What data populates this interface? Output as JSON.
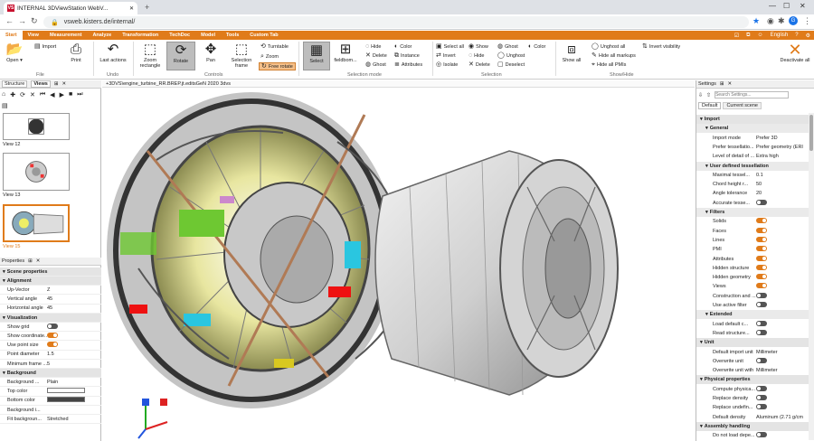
{
  "browser": {
    "tab_title": "INTERNAL 3DViewStation WebV...",
    "favicon_text": "VS",
    "new_tab": "+",
    "url": "vsweb.kisters.de/internal/",
    "profile_initial": "G"
  },
  "menu": {
    "items": [
      "Start",
      "View",
      "Measurement",
      "Analyze",
      "Transformation",
      "TechDoc",
      "Model",
      "Tools",
      "Custom Tab"
    ],
    "active": "Start",
    "language": "English"
  },
  "ribbon": {
    "open": "Open",
    "import": "Import",
    "print": "Print",
    "last_actions": "Last actions",
    "zoom_rectangle": "Zoom rectangle",
    "rotate": "Rotate",
    "pan": "Pan",
    "selection_frame": "Selection frame",
    "turntable": "Turntable",
    "zoom": "Zoom",
    "free_rotate": "Free rotate",
    "select": "Select",
    "fieldbom": "fieldbom...",
    "hide": "Hide",
    "delete": "Delete",
    "ghost": "Ghost",
    "color": "Color",
    "instance": "Instance",
    "attributes": "Attributes",
    "select_all": "Select all",
    "invert": "Invert",
    "isolate": "Isolate",
    "show": "Show",
    "hide2": "Hide",
    "delete2": "Delete",
    "ghost2": "Ghost",
    "unghost": "Unghost",
    "deselect": "Deselect",
    "color2": "Color",
    "show_all": "Show all",
    "unghost_all": "Unghost all",
    "hide_all_markups": "Hide all markups",
    "hide_all_pmis": "Hide all PMIs",
    "invert_visibility": "Invert visibility",
    "deactivate_all": "Deactivate all",
    "groups": {
      "file": "File",
      "undo": "Undo",
      "controls": "Controls",
      "selection_mode": "Selection mode",
      "selection": "Selection",
      "show_hide": "Show/Hide"
    }
  },
  "left": {
    "tabs": [
      "Structure",
      "Views"
    ],
    "views": [
      {
        "label": "View 12"
      },
      {
        "label": "View 13"
      },
      {
        "label": "View 15"
      }
    ],
    "properties_title": "Properties",
    "properties": [
      {
        "type": "section",
        "label": "Scene properties"
      },
      {
        "type": "section",
        "label": "Alignment"
      },
      {
        "type": "row",
        "k": "Up-Vector",
        "v": "Z"
      },
      {
        "type": "row",
        "k": "Vertical angle",
        "v": "45"
      },
      {
        "type": "row",
        "k": "Horizontal angle",
        "v": "45"
      },
      {
        "type": "section",
        "label": "Visualization"
      },
      {
        "type": "toggle",
        "k": "Show grid",
        "on": false
      },
      {
        "type": "toggle",
        "k": "Show coordinate...",
        "on": true
      },
      {
        "type": "toggle",
        "k": "Use point size",
        "on": true
      },
      {
        "type": "row",
        "k": "Point diameter",
        "v": "1.5"
      },
      {
        "type": "row",
        "k": "Minimum frame ...",
        "v": "5"
      },
      {
        "type": "section",
        "label": "Background"
      },
      {
        "type": "row",
        "k": "Background ...",
        "v": "Plain"
      },
      {
        "type": "color",
        "k": "Top color",
        "c": "#ffffff"
      },
      {
        "type": "color",
        "k": "Bottom color",
        "c": "#444444"
      },
      {
        "type": "row",
        "k": "Background i...",
        "v": ""
      },
      {
        "type": "row",
        "k": "Fit backgroun...",
        "v": "Stretched"
      }
    ]
  },
  "viewport": {
    "file_path": "+3DVS\\engine_turbine_RR.BREP.jt.editsGeN 2020 3dvs"
  },
  "settings": {
    "title": "Settings",
    "search_placeholder": "Search Settings...",
    "tabs": [
      "Default",
      "Current scene"
    ],
    "rows": [
      {
        "type": "sec",
        "label": "Import"
      },
      {
        "type": "sub",
        "label": "General"
      },
      {
        "type": "row",
        "k": "Import mode",
        "v": "Prefer 3D"
      },
      {
        "type": "row",
        "k": "Prefer tessellatio...",
        "v": "Prefer geometry (ERI"
      },
      {
        "type": "row",
        "k": "Level of detail of ...",
        "v": "Extra high"
      },
      {
        "type": "sub",
        "label": "User defined tessellation"
      },
      {
        "type": "row",
        "k": "Maximal tessel...",
        "v": "0.1"
      },
      {
        "type": "row",
        "k": "Chord height r...",
        "v": "50"
      },
      {
        "type": "row",
        "k": "Angle tolerance",
        "v": "20"
      },
      {
        "type": "toggle",
        "k": "Accurate tesse...",
        "on": false
      },
      {
        "type": "sub",
        "label": "Filters"
      },
      {
        "type": "toggle",
        "k": "Solids",
        "on": true
      },
      {
        "type": "toggle",
        "k": "Faces",
        "on": true
      },
      {
        "type": "toggle",
        "k": "Lines",
        "on": true
      },
      {
        "type": "toggle",
        "k": "PMI",
        "on": true
      },
      {
        "type": "toggle",
        "k": "Attributes",
        "on": true
      },
      {
        "type": "toggle",
        "k": "Hidden structure",
        "on": true
      },
      {
        "type": "toggle",
        "k": "Hidden geometry",
        "on": true
      },
      {
        "type": "toggle",
        "k": "Views",
        "on": true
      },
      {
        "type": "toggle",
        "k": "Construction and ...",
        "on": false
      },
      {
        "type": "toggle",
        "k": "Use active filter",
        "on": false
      },
      {
        "type": "sub",
        "label": "Extended"
      },
      {
        "type": "toggle",
        "k": "Load default c...",
        "on": false
      },
      {
        "type": "toggle",
        "k": "Read structure...",
        "on": false
      },
      {
        "type": "sec",
        "label": "Unit"
      },
      {
        "type": "row",
        "k": "Default import unit",
        "v": "Millimeter"
      },
      {
        "type": "toggle",
        "k": "Overwrite unit",
        "on": false
      },
      {
        "type": "row",
        "k": "Overwrite unit with",
        "v": "Millimeter"
      },
      {
        "type": "sec",
        "label": "Physical properties"
      },
      {
        "type": "toggle",
        "k": "Compute physica...",
        "on": false
      },
      {
        "type": "toggle",
        "k": "Replace density",
        "on": false
      },
      {
        "type": "toggle",
        "k": "Replace undefin...",
        "on": false
      },
      {
        "type": "row",
        "k": "Default density",
        "v": "Aluminum (2.71 g/cm"
      },
      {
        "type": "sec",
        "label": "Assembly handling"
      },
      {
        "type": "toggle",
        "k": "Do not load depe...",
        "on": false
      }
    ]
  }
}
